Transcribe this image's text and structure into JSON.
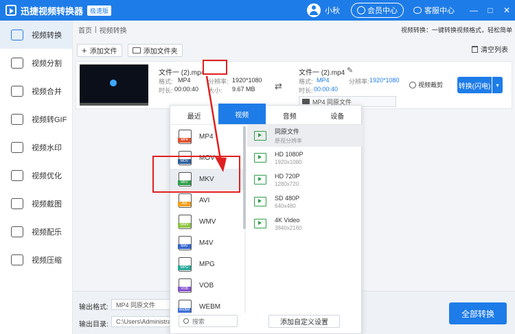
{
  "titlebar": {
    "app_title": "迅捷视频转换器",
    "badge": "极速版",
    "username": "小秋",
    "vip": "会员中心",
    "support": "客服中心",
    "minimize": "—",
    "maximize": "□",
    "close": "✕"
  },
  "sidebar": {
    "items": [
      {
        "label": "视频转换",
        "icon": "convert-icon",
        "active": true
      },
      {
        "label": "视频分割",
        "icon": "split-icon"
      },
      {
        "label": "视频合并",
        "icon": "merge-icon"
      },
      {
        "label": "视频转GIF",
        "icon": "gif-icon"
      },
      {
        "label": "视频水印",
        "icon": "watermark-icon"
      },
      {
        "label": "视频优化",
        "icon": "optimize-icon"
      },
      {
        "label": "视频截图",
        "icon": "screenshot-icon"
      },
      {
        "label": "视频配乐",
        "icon": "music-icon"
      },
      {
        "label": "视频压缩",
        "icon": "compress-icon"
      }
    ]
  },
  "breadcrumb": {
    "home": "首页",
    "sep": "|",
    "current": "视频转换",
    "desc": "视频转换：一键转换视频格式，轻松简单"
  },
  "toolbar": {
    "add_file": "添加文件",
    "add_folder": "添加文件夹",
    "clear": "清空列表"
  },
  "file": {
    "name": "文件一 (2).mp4",
    "format_label": "格式:",
    "format": "MP4",
    "res_label": "分辨率:",
    "res": "1920*1080",
    "dur_label": "时长:",
    "dur": "00:00:40",
    "size_label": "大小:",
    "size": "9.67 MB",
    "out_name": "文件一 (2).mp4",
    "out_format": "MP4",
    "out_res": "1920*1080",
    "out_dur": "00:00:40",
    "select": "MP4  同原文件",
    "clip": "视频裁剪",
    "convert": "转换(闪电)",
    "convert_drop": "▾"
  },
  "popup": {
    "tabs": [
      "最近",
      "视频",
      "音频",
      "设备"
    ],
    "active_tab": 1,
    "formats": [
      {
        "name": "MP4",
        "color": "#e0522e"
      },
      {
        "name": "MOV",
        "color": "#2c5f9e"
      },
      {
        "name": "MKV",
        "color": "#2e9e4a",
        "selected": true
      },
      {
        "name": "AVI",
        "color": "#f0a020"
      },
      {
        "name": "WMV",
        "color": "#8cc63e"
      },
      {
        "name": "M4V",
        "color": "#3366cc"
      },
      {
        "name": "MPG",
        "color": "#2aa89a"
      },
      {
        "name": "VOB",
        "color": "#8855cc"
      },
      {
        "name": "WEBM",
        "color": "#3a6fd8"
      }
    ],
    "resolutions": [
      {
        "name": "同原文件",
        "sub": "原视分辨率",
        "selected": true
      },
      {
        "name": "HD 1080P",
        "sub": "1920x1080"
      },
      {
        "name": "HD 720P",
        "sub": "1280x720"
      },
      {
        "name": "SD 480P",
        "sub": "640x480"
      },
      {
        "name": "4K Video",
        "sub": "3840x2160"
      }
    ],
    "search_placeholder": "搜索",
    "custom": "添加自定义设置"
  },
  "bottom": {
    "out_format_label": "输出格式:",
    "out_format": "MP4  同原文件",
    "out_dir_label": "输出目录:",
    "out_dir": "C:\\Users\\Administrat",
    "all_convert": "全部转换"
  },
  "colors": {
    "accent": "#1e7ce8",
    "highlight": "#e02020"
  }
}
